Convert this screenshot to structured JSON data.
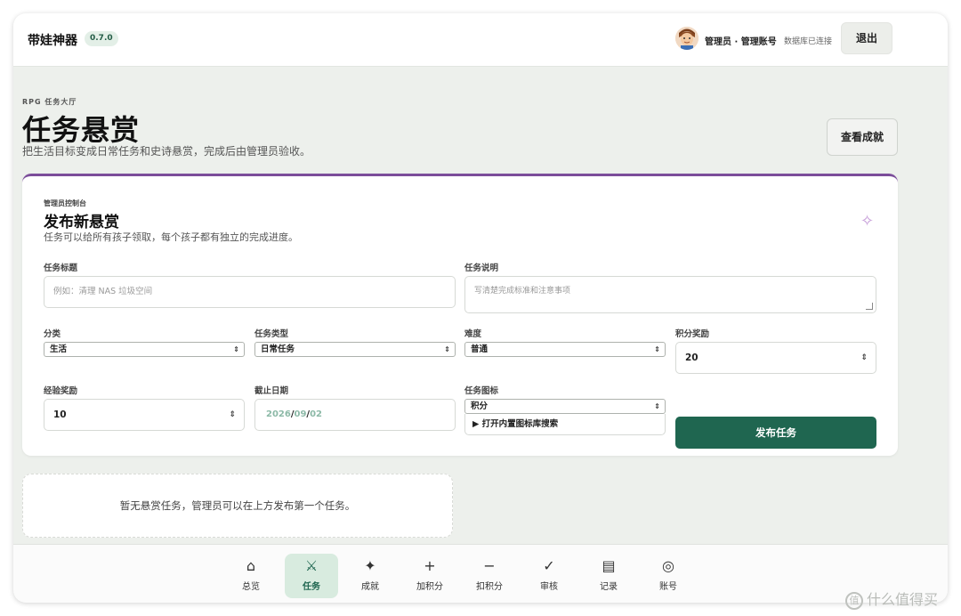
{
  "header": {
    "app_name": "带娃神器",
    "version": "0.7.0",
    "user_label": "管理员 · 管理账号",
    "db_status": "数据库已连接",
    "logout_label": "退出"
  },
  "page": {
    "eyebrow": "RPG 任务大厅",
    "title": "任务悬赏",
    "subtitle": "把生活目标变成日常任务和史诗悬赏，完成后由管理员验收。",
    "achievements_label": "查看成就"
  },
  "form": {
    "eyebrow": "管理员控制台",
    "title": "发布新悬赏",
    "subtitle": "任务可以给所有孩子领取，每个孩子都有独立的完成进度。",
    "sparkle_icon": "✧",
    "task_title": {
      "label": "任务标题",
      "placeholder": "例如：清理 NAS 垃圾空间"
    },
    "task_desc": {
      "label": "任务说明",
      "placeholder": "写清楚完成标准和注意事项"
    },
    "category": {
      "label": "分类",
      "value": "生活"
    },
    "task_type": {
      "label": "任务类型",
      "value": "日常任务"
    },
    "difficulty": {
      "label": "难度",
      "value": "普通"
    },
    "points_reward": {
      "label": "积分奖励",
      "value": "20"
    },
    "xp_reward": {
      "label": "经验奖励",
      "value": "10"
    },
    "deadline": {
      "label": "截止日期",
      "year": "2026",
      "month": "09",
      "day": "02",
      "sep": "/"
    },
    "task_icon": {
      "label": "任务图标",
      "value": "积分",
      "library_toggle": "▶ 打开内置图标库搜索"
    },
    "publish_label": "发布任务"
  },
  "empty_state": "暂无悬赏任务，管理员可以在上方发布第一个任务。",
  "nav": [
    {
      "icon": "⌂",
      "label": "总览"
    },
    {
      "icon": "⚔",
      "label": "任务"
    },
    {
      "icon": "✦",
      "label": "成就"
    },
    {
      "icon": "+",
      "label": "加积分"
    },
    {
      "icon": "−",
      "label": "扣积分"
    },
    {
      "icon": "✓",
      "label": "审核"
    },
    {
      "icon": "▤",
      "label": "记录"
    },
    {
      "icon": "◎",
      "label": "账号"
    }
  ],
  "watermark": {
    "logo": "值",
    "text": "什么值得买"
  },
  "colors": {
    "accent": "#1f6650",
    "card_top_border": "#7b4d9a",
    "background": "#edf0ec"
  }
}
